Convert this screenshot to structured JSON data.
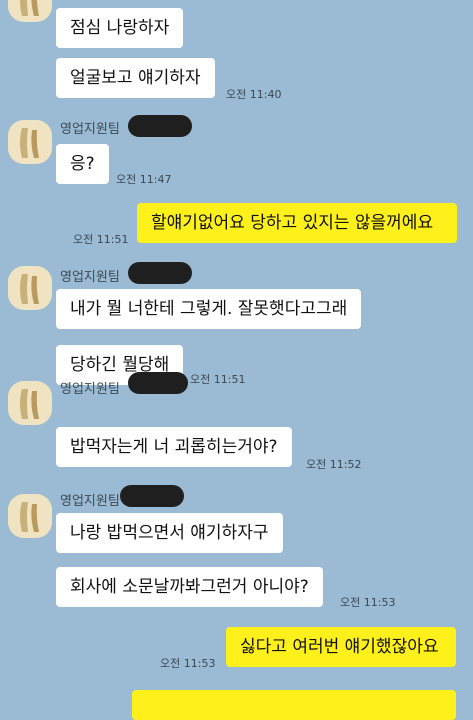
{
  "chat": {
    "sender_name": "영업지원팀",
    "messages": [
      {
        "from": "other",
        "text": "점심 나랑하자"
      },
      {
        "from": "other",
        "text": "얼굴보고 얘기하자",
        "time": "오전 11:40"
      },
      {
        "from": "other",
        "text": "응?",
        "time": "오전 11:47"
      },
      {
        "from": "me",
        "text": "할얘기없어요 당하고 있지는 않을꺼에요",
        "time": "오전 11:51"
      },
      {
        "from": "other",
        "text": "내가 뭘 너한테 그렇게. 잘못햇다고그래"
      },
      {
        "from": "other",
        "text": "당하긴 뭘당해",
        "time": "오전 11:51"
      },
      {
        "from": "other",
        "text": "밥먹자는게 너 괴롭히는거야?",
        "time": "오전 11:52"
      },
      {
        "from": "other",
        "text": "나랑 밥먹으면서 얘기하자구"
      },
      {
        "from": "other",
        "text": "회사에 소문날까봐그런거 아니야?",
        "time": "오전 11:53"
      },
      {
        "from": "me",
        "text": "싫다고 여러번 얘기했잖아요",
        "time": "오전 11:53"
      }
    ]
  },
  "colors": {
    "background": "#9bbbd4",
    "incoming_bubble": "#ffffff",
    "outgoing_bubble": "#fef01b"
  }
}
